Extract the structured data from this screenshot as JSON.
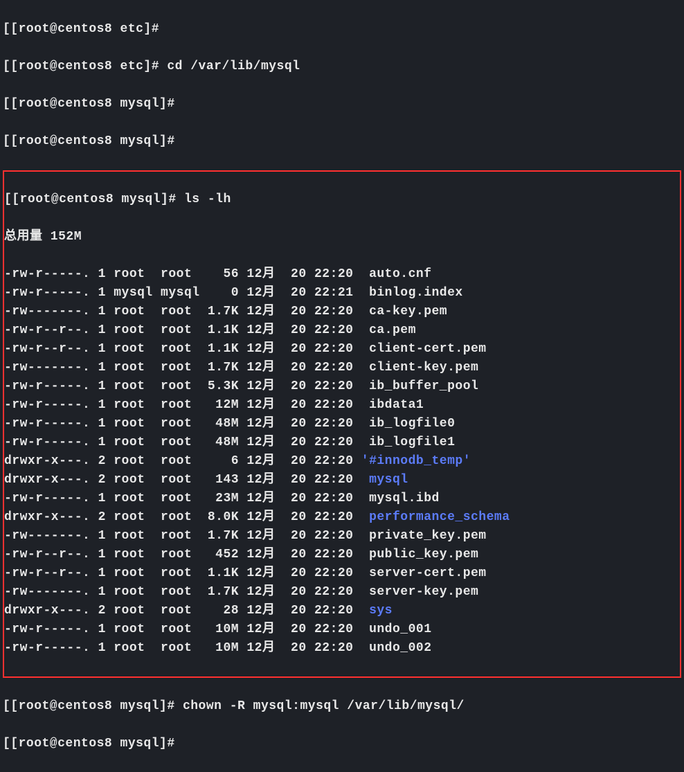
{
  "lines": {
    "l0": "[[root@centos8 etc]#",
    "l1": "[[root@centos8 etc]# cd /var/lib/mysql",
    "l2": "[[root@centos8 mysql]#",
    "l3": "[[root@centos8 mysql]#",
    "l4": "[[root@centos8 mysql]# ls -lh",
    "l5": "总用量 152M",
    "files": [
      {
        "perms": "-rw-r-----.",
        "links": "1",
        "user": "root ",
        "group": "root ",
        "size": "  56",
        "month": "12月",
        "day": " 20",
        "time": "22:20",
        "name": " auto.cnf",
        "isDir": false
      },
      {
        "perms": "-rw-r-----.",
        "links": "1",
        "user": "mysql",
        "group": "mysql",
        "size": "   0",
        "month": "12月",
        "day": " 20",
        "time": "22:21",
        "name": " binlog.index",
        "isDir": false
      },
      {
        "perms": "-rw-------.",
        "links": "1",
        "user": "root ",
        "group": "root ",
        "size": "1.7K",
        "month": "12月",
        "day": " 20",
        "time": "22:20",
        "name": " ca-key.pem",
        "isDir": false
      },
      {
        "perms": "-rw-r--r--.",
        "links": "1",
        "user": "root ",
        "group": "root ",
        "size": "1.1K",
        "month": "12月",
        "day": " 20",
        "time": "22:20",
        "name": " ca.pem",
        "isDir": false
      },
      {
        "perms": "-rw-r--r--.",
        "links": "1",
        "user": "root ",
        "group": "root ",
        "size": "1.1K",
        "month": "12月",
        "day": " 20",
        "time": "22:20",
        "name": " client-cert.pem",
        "isDir": false
      },
      {
        "perms": "-rw-------.",
        "links": "1",
        "user": "root ",
        "group": "root ",
        "size": "1.7K",
        "month": "12月",
        "day": " 20",
        "time": "22:20",
        "name": " client-key.pem",
        "isDir": false
      },
      {
        "perms": "-rw-r-----.",
        "links": "1",
        "user": "root ",
        "group": "root ",
        "size": "5.3K",
        "month": "12月",
        "day": " 20",
        "time": "22:20",
        "name": " ib_buffer_pool",
        "isDir": false
      },
      {
        "perms": "-rw-r-----.",
        "links": "1",
        "user": "root ",
        "group": "root ",
        "size": " 12M",
        "month": "12月",
        "day": " 20",
        "time": "22:20",
        "name": " ibdata1",
        "isDir": false
      },
      {
        "perms": "-rw-r-----.",
        "links": "1",
        "user": "root ",
        "group": "root ",
        "size": " 48M",
        "month": "12月",
        "day": " 20",
        "time": "22:20",
        "name": " ib_logfile0",
        "isDir": false
      },
      {
        "perms": "-rw-r-----.",
        "links": "1",
        "user": "root ",
        "group": "root ",
        "size": " 48M",
        "month": "12月",
        "day": " 20",
        "time": "22:20",
        "name": " ib_logfile1",
        "isDir": false
      },
      {
        "perms": "drwxr-x---.",
        "links": "2",
        "user": "root ",
        "group": "root ",
        "size": "   6",
        "month": "12月",
        "day": " 20",
        "time": "22:20",
        "name": "'#innodb_temp'",
        "isDir": true
      },
      {
        "perms": "drwxr-x---.",
        "links": "2",
        "user": "root ",
        "group": "root ",
        "size": " 143",
        "month": "12月",
        "day": " 20",
        "time": "22:20",
        "name": " mysql",
        "isDir": true
      },
      {
        "perms": "-rw-r-----.",
        "links": "1",
        "user": "root ",
        "group": "root ",
        "size": " 23M",
        "month": "12月",
        "day": " 20",
        "time": "22:20",
        "name": " mysql.ibd",
        "isDir": false
      },
      {
        "perms": "drwxr-x---.",
        "links": "2",
        "user": "root ",
        "group": "root ",
        "size": "8.0K",
        "month": "12月",
        "day": " 20",
        "time": "22:20",
        "name": " performance_schema",
        "isDir": true
      },
      {
        "perms": "-rw-------.",
        "links": "1",
        "user": "root ",
        "group": "root ",
        "size": "1.7K",
        "month": "12月",
        "day": " 20",
        "time": "22:20",
        "name": " private_key.pem",
        "isDir": false
      },
      {
        "perms": "-rw-r--r--.",
        "links": "1",
        "user": "root ",
        "group": "root ",
        "size": " 452",
        "month": "12月",
        "day": " 20",
        "time": "22:20",
        "name": " public_key.pem",
        "isDir": false
      },
      {
        "perms": "-rw-r--r--.",
        "links": "1",
        "user": "root ",
        "group": "root ",
        "size": "1.1K",
        "month": "12月",
        "day": " 20",
        "time": "22:20",
        "name": " server-cert.pem",
        "isDir": false
      },
      {
        "perms": "-rw-------.",
        "links": "1",
        "user": "root ",
        "group": "root ",
        "size": "1.7K",
        "month": "12月",
        "day": " 20",
        "time": "22:20",
        "name": " server-key.pem",
        "isDir": false
      },
      {
        "perms": "drwxr-x---.",
        "links": "2",
        "user": "root ",
        "group": "root ",
        "size": "  28",
        "month": "12月",
        "day": " 20",
        "time": "22:20",
        "name": " sys",
        "isDir": true
      },
      {
        "perms": "-rw-r-----.",
        "links": "1",
        "user": "root ",
        "group": "root ",
        "size": " 10M",
        "month": "12月",
        "day": " 20",
        "time": "22:20",
        "name": " undo_001",
        "isDir": false
      },
      {
        "perms": "-rw-r-----.",
        "links": "1",
        "user": "root ",
        "group": "root ",
        "size": " 10M",
        "month": "12月",
        "day": " 20",
        "time": "22:20",
        "name": " undo_002",
        "isDir": false
      }
    ],
    "l_after1": "[[root@centos8 mysql]# chown -R mysql:mysql /var/lib/mysql/",
    "l_after2": "[[root@centos8 mysql]#"
  }
}
